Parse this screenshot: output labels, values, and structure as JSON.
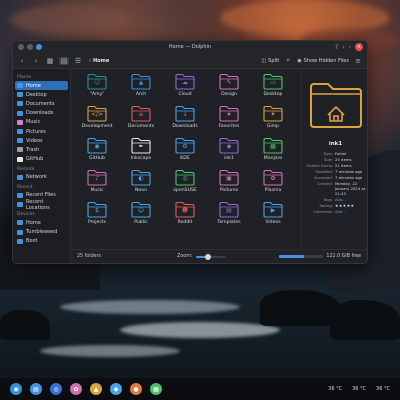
{
  "window": {
    "title": "Home — Dolphin",
    "controls": [
      "?",
      "‹",
      "›",
      "×"
    ]
  },
  "toolbar": {
    "back_icon": "arrow-left-icon",
    "forward_icon": "arrow-right-icon",
    "breadcrumb": "Home",
    "split_label": "Split",
    "show_hidden_label": "Show Hidden Files"
  },
  "sidebar": {
    "places_header": "Places",
    "places": [
      {
        "label": "Home",
        "color": "#4a90e2",
        "selected": true
      },
      {
        "label": "Desktop",
        "color": "#4a90e2"
      },
      {
        "label": "Documents",
        "color": "#4a90e2"
      },
      {
        "label": "Downloads",
        "color": "#4a90e2"
      },
      {
        "label": "Music",
        "color": "#e07bd4"
      },
      {
        "label": "Pictures",
        "color": "#4a90e2"
      },
      {
        "label": "Videos",
        "color": "#4a90e2"
      },
      {
        "label": "Trash",
        "color": "#9aa0a8"
      },
      {
        "label": "GitHub",
        "color": "#e6e8eb"
      }
    ],
    "remote_header": "Remote",
    "remote": [
      {
        "label": "Network",
        "color": "#4a90e2"
      }
    ],
    "recent_header": "Recent",
    "recent": [
      {
        "label": "Recent Files",
        "color": "#4a90e2"
      },
      {
        "label": "Recent Locations",
        "color": "#4a90e2"
      }
    ],
    "devices_header": "Devices",
    "devices": [
      {
        "label": "Home",
        "color": "#4a90e2"
      },
      {
        "label": "Tumbleweed",
        "color": "#4a90e2"
      },
      {
        "label": "Boot",
        "color": "#4a90e2"
      }
    ]
  },
  "folders": [
    {
      "label": "\"Amy\"",
      "color": "#2c8f8f",
      "glyph": "☺"
    },
    {
      "label": "Arch",
      "color": "#3a8fd6",
      "glyph": "▲"
    },
    {
      "label": "Cloud",
      "color": "#8d6bd4",
      "glyph": "☁"
    },
    {
      "label": "Design",
      "color": "#d06fb0",
      "glyph": "✎"
    },
    {
      "label": "Desktop",
      "color": "#4fbf6a",
      "glyph": "▭"
    },
    {
      "label": "Development",
      "color": "#d9a340",
      "glyph": "</>"
    },
    {
      "label": "Documents",
      "color": "#e05a5a",
      "glyph": "≡"
    },
    {
      "label": "Downloads",
      "color": "#4aa3e6",
      "glyph": "↓"
    },
    {
      "label": "Favorites",
      "color": "#d06fb0",
      "glyph": "★"
    },
    {
      "label": "Gimp",
      "color": "#d9a340",
      "glyph": "✦"
    },
    {
      "label": "GitHub",
      "color": "#4aa3e6",
      "glyph": "◉"
    },
    {
      "label": "Inkscape",
      "color": "#e6e8eb",
      "glyph": "✒"
    },
    {
      "label": "KDE",
      "color": "#4aa3e6",
      "glyph": "⚙"
    },
    {
      "label": "ink1",
      "color": "#8d6bd4",
      "glyph": "◆"
    },
    {
      "label": "Manjaro",
      "color": "#4fbf6a",
      "glyph": "▦"
    },
    {
      "label": "Music",
      "color": "#d06fb0",
      "glyph": "♪"
    },
    {
      "label": "Neon",
      "color": "#4aa3e6",
      "glyph": "◐"
    },
    {
      "label": "openSUSE",
      "color": "#4fbf6a",
      "glyph": "◎"
    },
    {
      "label": "Pictures",
      "color": "#d06fb0",
      "glyph": "▣"
    },
    {
      "label": "Plasma",
      "color": "#d06fb0",
      "glyph": "✿"
    },
    {
      "label": "Projects",
      "color": "#4aa3e6",
      "glyph": "$"
    },
    {
      "label": "Public",
      "color": "#4aa3e6",
      "glyph": "☺"
    },
    {
      "label": "Reddit",
      "color": "#e05a5a",
      "glyph": "☻"
    },
    {
      "label": "Templates",
      "color": "#8d6bd4",
      "glyph": "▤"
    },
    {
      "label": "Videos",
      "color": "#4aa3e6",
      "glyph": "▶"
    }
  ],
  "info_panel": {
    "name": "ink1",
    "accent": "#d9a340",
    "meta": [
      {
        "k": "Type:",
        "v": "Folder"
      },
      {
        "k": "Size:",
        "v": "25 items"
      },
      {
        "k": "Hidden items:",
        "v": "21 items"
      },
      {
        "k": "Modified:",
        "v": "7 minutes ago"
      },
      {
        "k": "Accessed:",
        "v": "7 minutes ago"
      },
      {
        "k": "Created:",
        "v": "Monday, 22 January 2024 at 21:43"
      },
      {
        "k": "Tags:",
        "v": "Add..."
      },
      {
        "k": "Rating:",
        "v": "★★★★★"
      },
      {
        "k": "Comment:",
        "v": "Add..."
      }
    ]
  },
  "statusbar": {
    "count": "25 folders",
    "zoom_label": "Zoom:",
    "zoom_level": 0.4,
    "free_space": "122.0 GiB free",
    "used_fraction": 0.55
  },
  "taskbar": {
    "apps": [
      {
        "name": "app-launcher-icon",
        "color": "#3a8fd6",
        "glyph": "◉"
      },
      {
        "name": "files-icon",
        "color": "#4a90e2",
        "glyph": "▤"
      },
      {
        "name": "browser-icon",
        "color": "#3a6fd6",
        "glyph": "◎"
      },
      {
        "name": "settings-icon",
        "color": "#d06fb0",
        "glyph": "✿"
      },
      {
        "name": "terminal-icon",
        "color": "#d9a340",
        "glyph": "▲"
      },
      {
        "name": "store-icon",
        "color": "#4aa3e6",
        "glyph": "◆"
      },
      {
        "name": "firefox-icon",
        "color": "#e07a3a",
        "glyph": "●"
      },
      {
        "name": "system-monitor-icon",
        "color": "#4fbf6a",
        "glyph": "▦"
      }
    ],
    "temps": [
      "36 °C",
      "36 °C",
      "36 °C"
    ]
  }
}
